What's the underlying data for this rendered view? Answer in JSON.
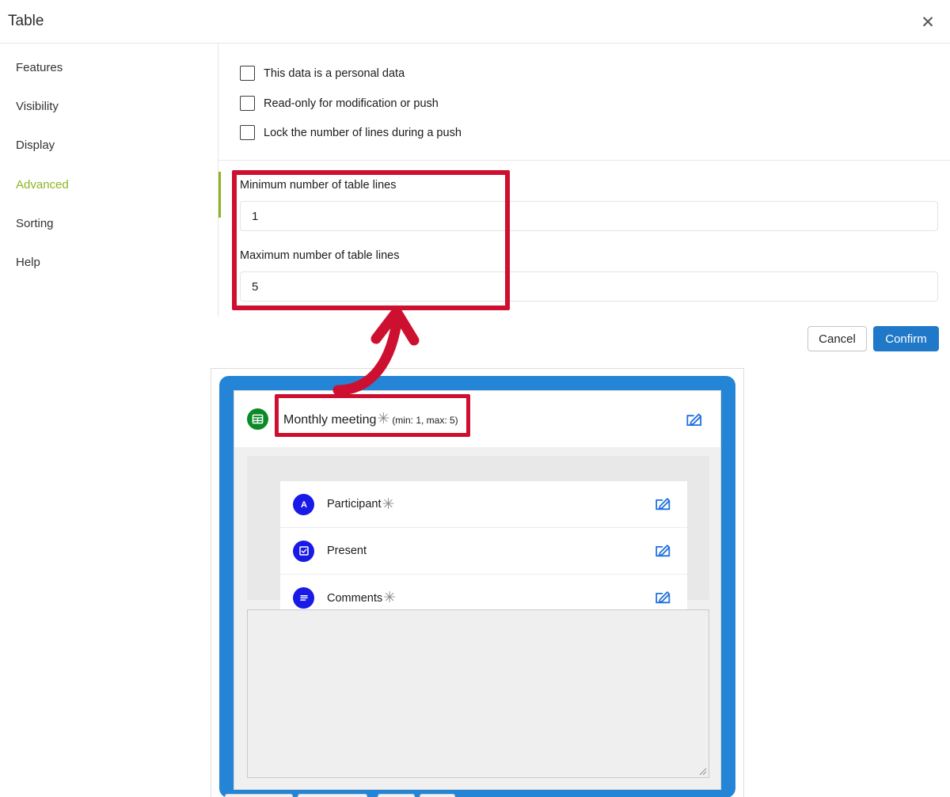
{
  "window": {
    "title": "Table",
    "close_icon": "close-icon"
  },
  "sidebar": {
    "items": [
      {
        "label": "Features",
        "active": false
      },
      {
        "label": "Visibility",
        "active": false
      },
      {
        "label": "Display",
        "active": false
      },
      {
        "label": "Advanced",
        "active": true
      },
      {
        "label": "Sorting",
        "active": false
      },
      {
        "label": "Help",
        "active": false
      }
    ],
    "active_color": "#8cb522"
  },
  "content": {
    "checkboxes": [
      {
        "label": "This data is a personal data",
        "checked": false
      },
      {
        "label": "Read-only for modification or push",
        "checked": false
      },
      {
        "label": "Lock the number of lines during a push",
        "checked": false
      }
    ],
    "fields": [
      {
        "label": "Minimum number of table lines",
        "value": "1"
      },
      {
        "label": "Maximum number of table lines",
        "value": "5"
      }
    ]
  },
  "footer": {
    "cancel_label": "Cancel",
    "confirm_label": "Confirm",
    "confirm_color": "#2079c8"
  },
  "preview": {
    "card_color": "#2484d6",
    "header": {
      "icon": "table-icon",
      "icon_color": "#0b8a27",
      "title": "Monthly meeting",
      "required_marker": "✳",
      "constraints": "(min: 1, max: 5)",
      "edit_icon": "edit-pencil-icon"
    },
    "fields": [
      {
        "icon": "attribute-a-icon",
        "label": "Participant",
        "required_marker": "✳",
        "required": true,
        "edit_icon": "edit-pencil-icon"
      },
      {
        "icon": "checkbox-icon",
        "label": "Present",
        "required_marker": "",
        "required": false,
        "edit_icon": "edit-pencil-icon"
      },
      {
        "icon": "text-lines-icon",
        "label": "Comments",
        "required_marker": "✳",
        "required": true,
        "edit_icon": "edit-pencil-icon"
      }
    ],
    "icon_color": "#1a1ae6",
    "textarea_value": ""
  },
  "annotations": {
    "highlight_color": "#ce1030",
    "boxes": [
      {
        "name": "advanced-fields-highlight"
      },
      {
        "name": "preview-title-highlight"
      }
    ],
    "arrow": {
      "name": "callout-arrow",
      "direction": "up"
    }
  }
}
